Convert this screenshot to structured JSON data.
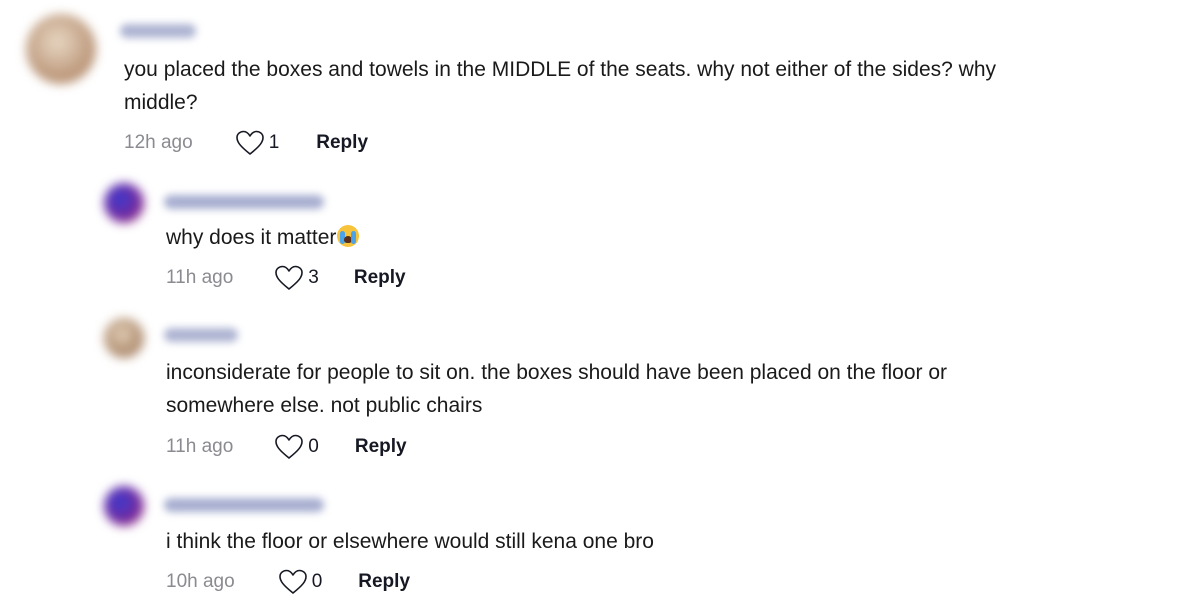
{
  "comments": [
    {
      "text_lines": [
        "you placed the boxes and towels in the MIDDLE of the seats. why not either of the sides? why",
        "middle?"
      ],
      "time": "12h ago",
      "likes": "1",
      "reply_label": "Reply",
      "username_color": "#a8b0d0",
      "avatar_color": "#c9a98a"
    },
    {
      "text": "why does it matter",
      "time": "11h ago",
      "likes": "3",
      "reply_label": "Reply",
      "username_color": "#9aa2c8",
      "avatar_color": "#6b2fa0"
    },
    {
      "text_lines": [
        "inconsiderate for people to sit on. the boxes should have been placed on the floor or",
        "somewhere else. not public chairs"
      ],
      "time": "11h ago",
      "likes": "0",
      "reply_label": "Reply",
      "username_color": "#a8b0d0",
      "avatar_color": "#c9a98a"
    },
    {
      "text": "i think the floor or elsewhere would still kena one bro",
      "time": "10h ago",
      "likes": "0",
      "reply_label": "Reply",
      "username_color": "#9aa2c8",
      "avatar_color": "#6b2fa0"
    }
  ],
  "icons": {
    "like": "heart-outline-icon",
    "emoji": "loudly-crying-face-emoji"
  }
}
